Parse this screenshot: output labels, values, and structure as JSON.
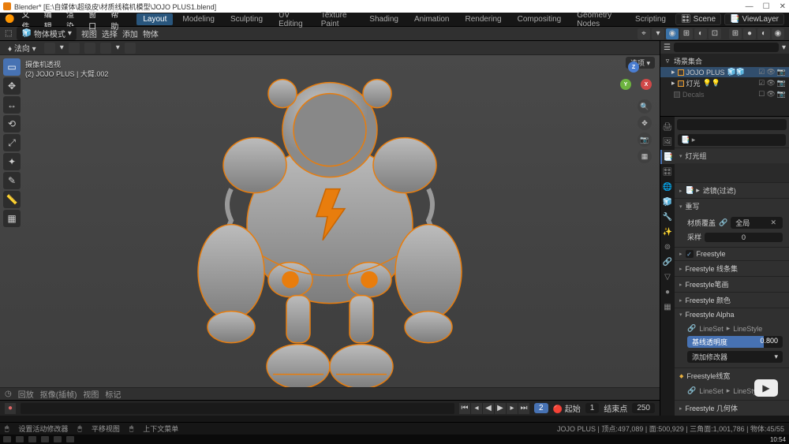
{
  "titlebar": {
    "title": "Blender* [E:\\自媒体\\超级皮\\材质线稿机模型\\JOJO PLUS1.blend]"
  },
  "menu": {
    "items": [
      "文件",
      "编辑",
      "渲染",
      "窗口",
      "帮助"
    ]
  },
  "workspaces": {
    "tabs": [
      "Layout",
      "Modeling",
      "Sculpting",
      "UV Editing",
      "Texture Paint",
      "Shading",
      "Animation",
      "Rendering",
      "Compositing",
      "Geometry Nodes",
      "Scripting"
    ],
    "active": 0
  },
  "scene": {
    "label": "Scene",
    "viewlayer": "ViewLayer"
  },
  "mode": {
    "label": "物体模式"
  },
  "header2": {
    "items": [
      "视图",
      "选择",
      "添加",
      "物体"
    ]
  },
  "vp_header": {
    "orient": "法向",
    "options": "选项"
  },
  "vp_info": {
    "line1": "摄像机透视",
    "line2": "(2) JOJO PLUS | 大臂.002"
  },
  "gizmo": {
    "x": "X",
    "y": "Y",
    "z": "Z"
  },
  "vp_bottom": {
    "playback": "回放",
    "keying": "抠像(插帧)",
    "view": "视图",
    "marker": "标记"
  },
  "timeline": {
    "current": 2,
    "autokey": "起始",
    "start": 1,
    "endlabel": "结束点",
    "end": 250
  },
  "outliner": {
    "root": "场景集合",
    "items": [
      {
        "name": "JOJO PLUS",
        "icon": "collection",
        "sel": true
      },
      {
        "name": "灯光",
        "icon": "collection"
      },
      {
        "name": "Decals",
        "icon": "collection"
      }
    ]
  },
  "props": {
    "breadcrumb": "",
    "panels": {
      "light_group": "灯光组",
      "filter": "滤镜(过滤)",
      "rewrite": "重写",
      "mat_override": "材质覆盖",
      "global": "全局",
      "sample": "采样",
      "sample_val": "0",
      "freestyle": "Freestyle",
      "fs_lineset_panel": "Freestyle 线条集",
      "fs_stroke": "Freestyle笔画",
      "fs_color": "Freestyle 颜色",
      "fs_alpha": "Freestyle Alpha",
      "lineset": "LineSet",
      "linestyle": "LineStyle",
      "base_alpha_label": "基线透明度",
      "base_alpha_val": "0.800",
      "add_modifier": "添加修改器",
      "fs_width": "Freestyle线宽",
      "fs_geom": "Freestyle 几何体"
    }
  },
  "status": {
    "left1": "设置活动修改器",
    "left2": "平移视图",
    "left3": "上下文菜单",
    "right": "JOJO PLUS | 顶点:497,089 | 面:500,929 | 三角面:1,001,786 | 物体:45/55"
  },
  "taskbar": {
    "clock": "10:54"
  }
}
